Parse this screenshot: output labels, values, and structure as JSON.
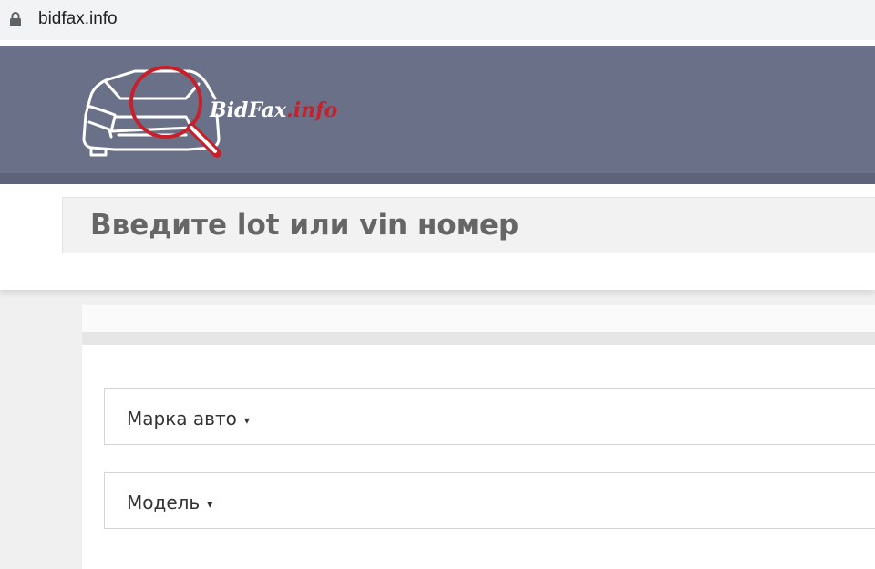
{
  "browser": {
    "url": "bidfax.info"
  },
  "header": {
    "logo_text_main": "BidFax",
    "logo_text_suffix": ".info"
  },
  "search": {
    "placeholder": "Введите lot или vin номер"
  },
  "filters": {
    "make_label": "Марка авто",
    "model_label": "Модель",
    "caret": "▾"
  },
  "colors": {
    "header_bg": "#6b7089",
    "logo_red": "#c8202a",
    "placeholder_text": "#666666"
  }
}
